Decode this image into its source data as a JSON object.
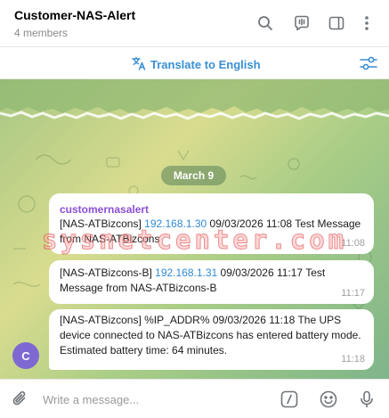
{
  "header": {
    "title": "Customer-NAS-Alert",
    "subtitle": "4 members",
    "icons": [
      "search-icon",
      "live-chat-icon",
      "sidebar-toggle-icon",
      "more-vertical-icon"
    ]
  },
  "translate_bar": {
    "label": "Translate to English",
    "icon": "translate-icon",
    "settings_icon": "filter-settings-icon"
  },
  "chat": {
    "date_label": "March 9",
    "watermark": "sysnetcenter.com",
    "messages": [
      {
        "sender": "customernasalert",
        "pre": "[NAS-ATBizcons] ",
        "ip": "192.168.1.30",
        "post": " 09/03/2026 11:08 Test Message from NAS-ATBizcons",
        "time": "11:08"
      },
      {
        "pre": "[NAS-ATBizcons-B] ",
        "ip": "192.168.1.31",
        "post": " 09/03/2026 11:17 Test Message from NAS-ATBizcons-B",
        "time": "11:17"
      },
      {
        "text": "[NAS-ATBizcons] %IP_ADDR% 09/03/2026 11:18 The UPS device connected to NAS-ATBizcons has entered battery mode. Estimated battery time: 64 minutes.",
        "time": "11:18"
      }
    ],
    "avatar_initial": "C"
  },
  "composer": {
    "placeholder": "Write a message...",
    "icons": [
      "attach-icon",
      "commands-icon",
      "emoji-icon",
      "microphone-icon"
    ]
  },
  "colors": {
    "accent": "#3a8fd4",
    "sender": "#8b4fd4",
    "link": "#2f8ad4",
    "avatar": "#7e68d2",
    "chat_bg": "#a7c783"
  }
}
